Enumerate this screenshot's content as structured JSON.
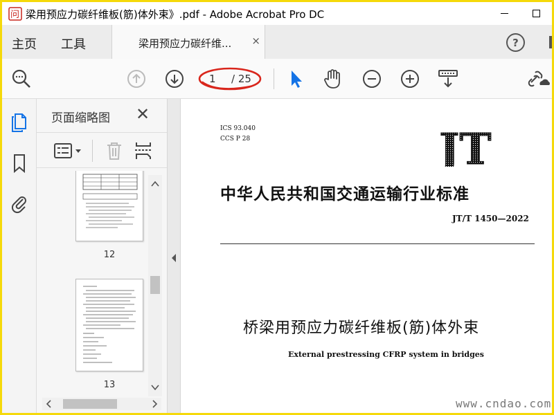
{
  "window": {
    "title": "梁用预应力碳纤维板(筋)体外束》.pdf - Adobe Acrobat Pro DC",
    "app_icon_text": "问",
    "app_icon_subtext": "蔚",
    "minimize_icon": "minimize-icon",
    "maximize_icon": "maximize-icon"
  },
  "tabs": {
    "home": "主页",
    "tools": "工具",
    "document": "梁用预应力碳纤维...",
    "close_glyph": "×",
    "help_glyph": "?"
  },
  "toolbar": {
    "page_current": "1",
    "page_total": "/ 25",
    "icons": [
      "search-icon",
      "page-up-icon",
      "page-down-icon",
      "select-pointer-icon",
      "hand-tool-icon",
      "zoom-out-icon",
      "zoom-in-icon",
      "scroll-mode-icon",
      "share-link-icon"
    ],
    "highlight_color": "#d9261c",
    "accent_color": "#1473e6"
  },
  "sidebar": {
    "icons": [
      "page-thumbnails-icon",
      "bookmarks-icon",
      "attachments-icon"
    ]
  },
  "thumbnail_panel": {
    "title": "页面缩略图",
    "close_glyph": "✕",
    "thumbnails": [
      {
        "label": "12"
      },
      {
        "label": "13"
      }
    ]
  },
  "document": {
    "ics": "ICS 93.040",
    "ccs": "CCS P 28",
    "logo": "JT",
    "standard_title": "中华人民共和国交通运输行业标准",
    "standard_code": "JT/T 1450—2022",
    "chinese_title": "桥梁用预应力碳纤维板(筋)体外束",
    "english_title": "External prestressing CFRP system in bridges",
    "watermark": "www.cndao.com"
  }
}
